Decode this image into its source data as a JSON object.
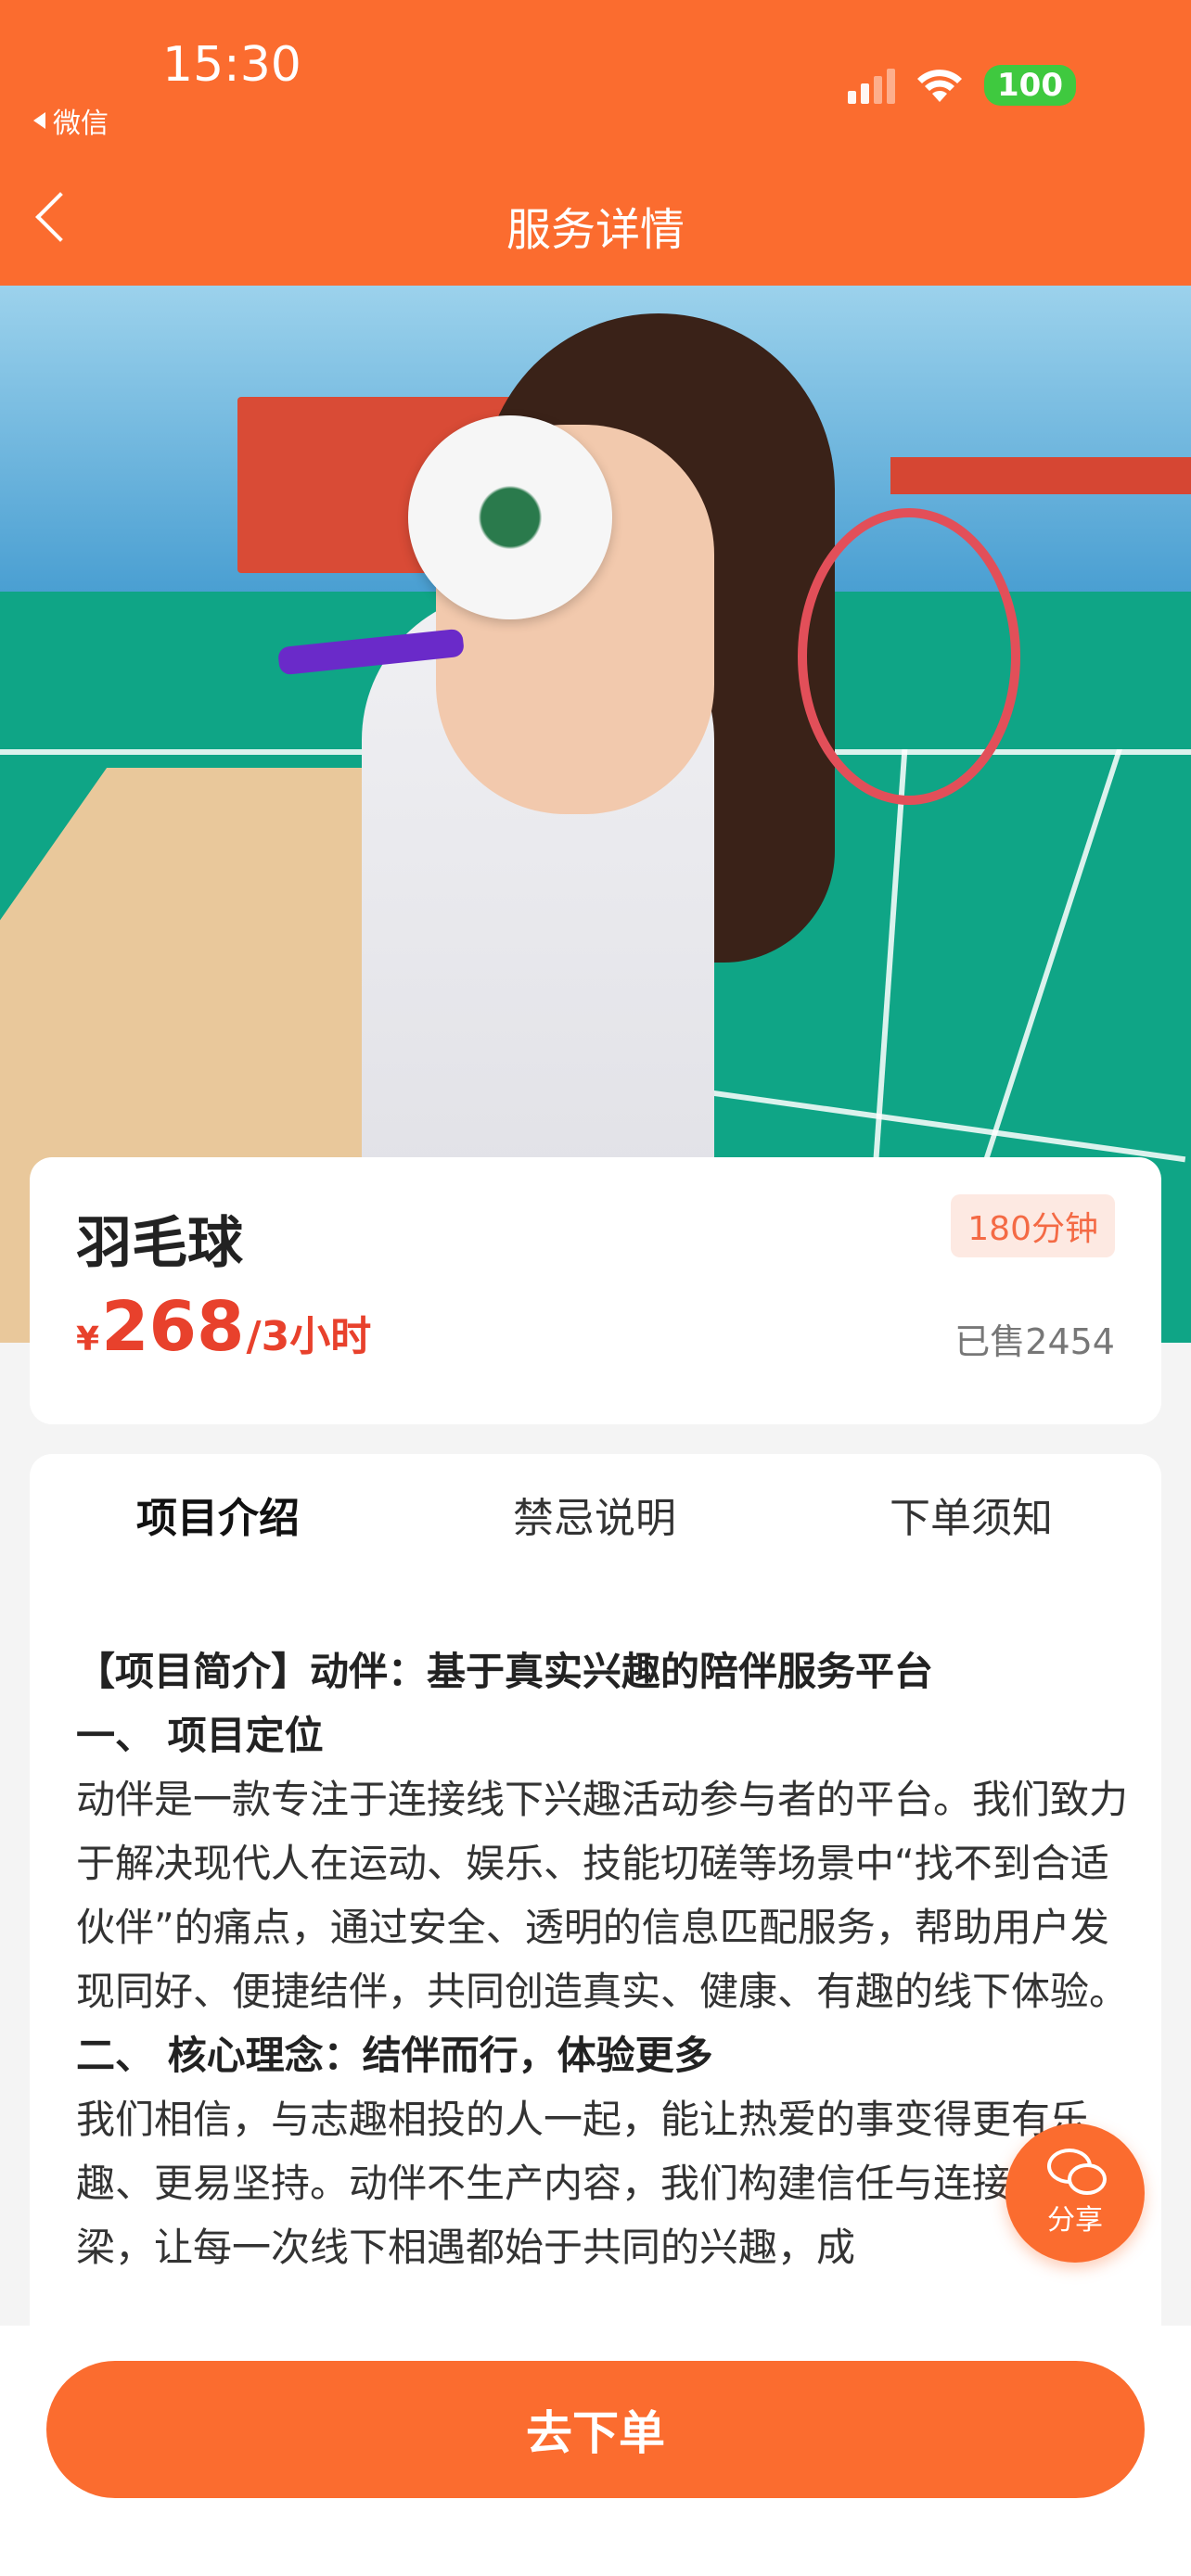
{
  "status_bar": {
    "time": "15:30",
    "back_app": "微信",
    "battery": "100"
  },
  "nav": {
    "title": "服务详情"
  },
  "service": {
    "name": "羽毛球",
    "duration_badge": "180分钟",
    "currency": "¥",
    "price": "268",
    "price_unit": "/3小时",
    "sold": "已售2454"
  },
  "tabs": [
    {
      "label": "项目介绍",
      "active": true
    },
    {
      "label": "禁忌说明",
      "active": false
    },
    {
      "label": "下单须知",
      "active": false
    }
  ],
  "content": {
    "line1": "【项目简介】动伴：基于真实兴趣的陪伴服务平台",
    "line2": "一、 项目定位",
    "para1": "动伴是一款专注于连接线下兴趣活动参与者的平台。我们致力于解决现代人在运动、娱乐、技能切磋等场景中“找不到合适伙伴”的痛点，通过安全、透明的信息匹配服务，帮助用户发现同好、便捷结伴，共同创造真实、健康、有趣的线下体验。",
    "line3": "二、 核心理念：结伴而行，体验更多",
    "para2": "我们相信，与志趣相投的人一起，能让热爱的事变得更有乐趣、更易坚持。动伴不生产内容，我们构建信任与连接的桥梁，让每一次线下相遇都始于共同的兴趣，成"
  },
  "share": {
    "label": "分享"
  },
  "bottom": {
    "order_button": "去下单"
  },
  "colors": {
    "accent": "#fb6c2f",
    "price": "#e8412c"
  }
}
